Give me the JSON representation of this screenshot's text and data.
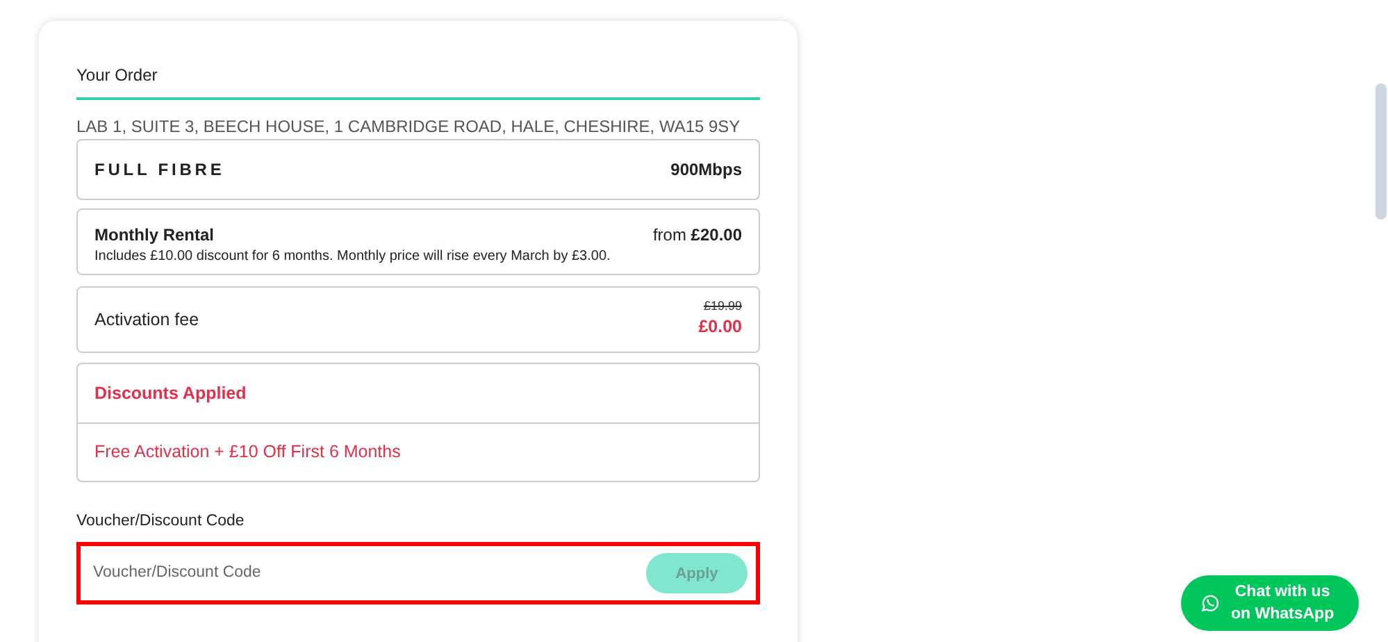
{
  "order": {
    "title": "Your Order",
    "address": "LAB 1, SUITE 3, BEECH HOUSE, 1 CAMBRIDGE ROAD, HALE, CHESHIRE, WA15 9SY",
    "product": {
      "name": "FULL FIBRE",
      "speed": "900Mbps"
    },
    "monthly_rental": {
      "label": "Monthly Rental",
      "price_prefix": "from",
      "price": "£20.00",
      "note": "Includes £10.00 discount for 6 months. Monthly price will rise every March by £3.00."
    },
    "activation": {
      "label": "Activation fee",
      "old_price": "£19.99",
      "price": "£0.00"
    },
    "discounts": {
      "heading": "Discounts Applied",
      "items": [
        "Free Activation + £10 Off First 6 Months"
      ]
    },
    "voucher": {
      "label": "Voucher/Discount Code",
      "placeholder": "Voucher/Discount Code",
      "highlighted": true,
      "button": {
        "label": "Apply",
        "disabled": true
      }
    }
  },
  "chat_button": {
    "line_1": "Chat with us",
    "line_2": "on WhatsApp"
  }
}
